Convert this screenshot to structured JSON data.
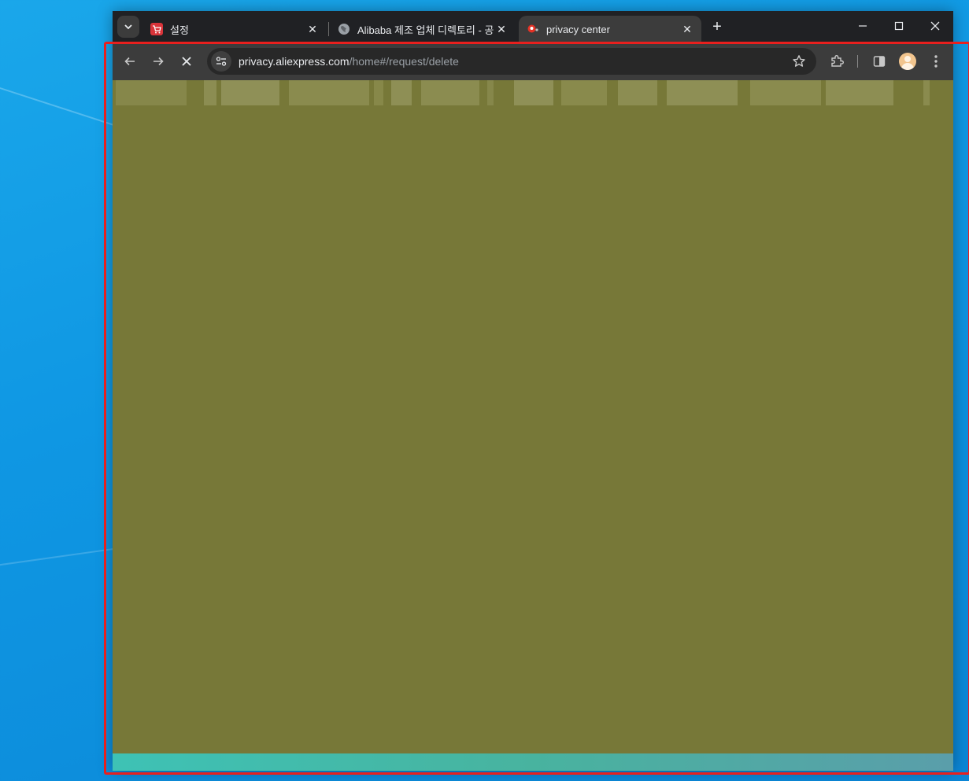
{
  "browser": {
    "tabs": [
      {
        "title": "설정",
        "favicon": "shopping-cart-icon",
        "active": false
      },
      {
        "title": "Alibaba 제조 업체 디렉토리 - 공",
        "favicon": "globe-icon",
        "active": false
      },
      {
        "title": "privacy center",
        "favicon": "aliexpress-icon",
        "active": true
      }
    ],
    "new_tab": "+",
    "window_controls": {
      "minimize": "–",
      "maximize": "☐",
      "close": "✕"
    },
    "toolbar": {
      "url_host": "privacy.aliexpress.com",
      "url_path": "/home#/request/delete",
      "loading": true
    }
  },
  "colors": {
    "desktop": "#1aa7ea",
    "page_overlay": "#777838",
    "highlight": "#e8201e",
    "tab_bg": "#202124",
    "toolbar_bg": "#3c3c3c"
  }
}
